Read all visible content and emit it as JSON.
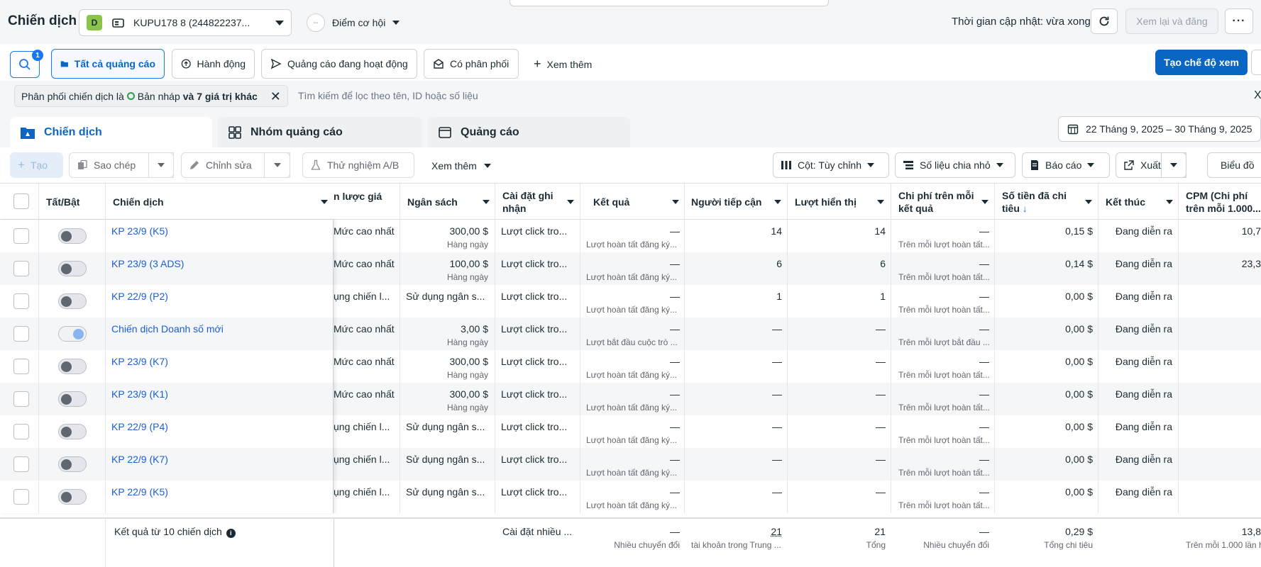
{
  "header": {
    "title": "Chiến dịch",
    "account_badge": "D",
    "account_name": "KUPU178 8 (244822237...",
    "opportunity_label": "Điểm cơ hội",
    "opportunity_icon": "--",
    "update_text": "Thời gian cập nhật: vừa xong",
    "review_label": "Xem lại và đăng"
  },
  "filters": {
    "search_badge": "1",
    "pills": [
      "Tất cả quảng cáo",
      "Hành động",
      "Quảng cáo đang hoạt động",
      "Có phân phối"
    ],
    "more_label": "Xem thêm",
    "create_view_label": "Tạo chế độ xem",
    "chip_prefix": "Phân phối chiến dịch là",
    "chip_value": "Bản nháp",
    "chip_suffix": "và 7 giá trị khác",
    "search_placeholder": "Tìm kiếm để lọc theo tên, ID hoặc số liệu",
    "clear_label": "X"
  },
  "levels": {
    "tabs": [
      "Chiến dịch",
      "Nhóm quảng cáo",
      "Quảng cáo"
    ],
    "date_range": "22 Tháng 9, 2025 – 30 Tháng 9, 2025"
  },
  "toolbar": {
    "create": "Tạo",
    "copy": "Sao chép",
    "edit": "Chỉnh sửa",
    "ab_test": "Thử nghiệm A/B",
    "more": "Xem thêm",
    "columns": "Cột: Tùy chỉnh",
    "breakdown": "Số liệu chia nhỏ",
    "reports": "Báo cáo",
    "export": "Xuất",
    "chart": "Biểu đồ"
  },
  "table": {
    "headers": {
      "toggle": "Tất/Bật",
      "campaign": "Chiến dịch",
      "bid": "n lược giá",
      "budget": "Ngân sách",
      "attribution_1": "Cài đặt ghi",
      "attribution_2": "nhận",
      "results": "Kết quả",
      "reach": "Người tiếp cận",
      "impressions": "Lượt hiển thị",
      "cpr_1": "Chi phí trên mỗi",
      "cpr_2": "kết quả",
      "spent_1": "Số tiền đã chi",
      "spent_2": "tiêu",
      "spent_sort": "↓",
      "ends": "Kết thúc",
      "cpm_1": "CPM (Chi phí",
      "cpm_2": "trên mỗi 1.000..."
    },
    "rows": [
      {
        "name": "KP 23/9 (K5)",
        "toggle": "off",
        "bid": "Mức cao nhất",
        "budget": "300,00 $",
        "budget_sub": "Hàng ngày",
        "attribution": "Lượt click tro...",
        "result": "—",
        "result_sub": "Lượt hoàn tất đăng ký...",
        "reach": "14",
        "impressions": "14",
        "cpr": "—",
        "cpr_sub": "Trên mỗi lượt hoàn tất...",
        "spent": "0,15 $",
        "ends": "Đang diễn ra",
        "cpm": "10,7"
      },
      {
        "name": "KP 23/9 (3 ADS)",
        "toggle": "off",
        "bid": "Mức cao nhất",
        "budget": "100,00 $",
        "budget_sub": "Hàng ngày",
        "attribution": "Lượt click tro...",
        "result": "—",
        "result_sub": "Lượt hoàn tất đăng ký...",
        "reach": "6",
        "impressions": "6",
        "cpr": "—",
        "cpr_sub": "Trên mỗi lượt hoàn tất...",
        "spent": "0,14 $",
        "ends": "Đang diễn ra",
        "cpm": "23,3"
      },
      {
        "name": "KP 22/9 (P2)",
        "toggle": "off",
        "bid": "ụng chiến l...",
        "budget": "Sử dụng ngân s...",
        "budget_sub": "",
        "attribution": "Lượt click tro...",
        "result": "—",
        "result_sub": "Lượt hoàn tất đăng ký...",
        "reach": "1",
        "impressions": "1",
        "cpr": "—",
        "cpr_sub": "Trên mỗi lượt hoàn tất...",
        "spent": "0,00 $",
        "ends": "Đang diễn ra",
        "cpm": ""
      },
      {
        "name": "Chiến dịch Doanh số mới",
        "toggle": "pending",
        "bid": "Mức cao nhất",
        "budget": "3,00 $",
        "budget_sub": "Hàng ngày",
        "attribution": "Lượt click tro...",
        "result": "—",
        "result_sub": "Lượt bắt đầu cuộc trò ...",
        "reach": "—",
        "impressions": "—",
        "cpr": "—",
        "cpr_sub": "Trên mỗi lượt bắt đầu ...",
        "spent": "0,00 $",
        "ends": "Đang diễn ra",
        "cpm": ""
      },
      {
        "name": "KP 23/9 (K7)",
        "toggle": "off",
        "bid": "Mức cao nhất",
        "budget": "300,00 $",
        "budget_sub": "Hàng ngày",
        "attribution": "Lượt click tro...",
        "result": "—",
        "result_sub": "Lượt hoàn tất đăng ký...",
        "reach": "—",
        "impressions": "—",
        "cpr": "—",
        "cpr_sub": "Trên mỗi lượt hoàn tất...",
        "spent": "0,00 $",
        "ends": "Đang diễn ra",
        "cpm": ""
      },
      {
        "name": "KP 23/9 (K1)",
        "toggle": "off",
        "bid": "Mức cao nhất",
        "budget": "300,00 $",
        "budget_sub": "Hàng ngày",
        "attribution": "Lượt click tro...",
        "result": "—",
        "result_sub": "Lượt hoàn tất đăng ký...",
        "reach": "—",
        "impressions": "—",
        "cpr": "—",
        "cpr_sub": "Trên mỗi lượt hoàn tất...",
        "spent": "0,00 $",
        "ends": "Đang diễn ra",
        "cpm": ""
      },
      {
        "name": "KP 22/9 (P4)",
        "toggle": "off",
        "bid": "ụng chiến l...",
        "budget": "Sử dụng ngân s...",
        "budget_sub": "",
        "attribution": "Lượt click tro...",
        "result": "—",
        "result_sub": "Lượt hoàn tất đăng ký...",
        "reach": "—",
        "impressions": "—",
        "cpr": "—",
        "cpr_sub": "Trên mỗi lượt hoàn tất...",
        "spent": "0,00 $",
        "ends": "Đang diễn ra",
        "cpm": ""
      },
      {
        "name": "KP 22/9 (K7)",
        "toggle": "off",
        "bid": "ụng chiến l...",
        "budget": "Sử dụng ngân s...",
        "budget_sub": "",
        "attribution": "Lượt click tro...",
        "result": "—",
        "result_sub": "Lượt hoàn tất đăng ký...",
        "reach": "—",
        "impressions": "—",
        "cpr": "—",
        "cpr_sub": "Trên mỗi lượt hoàn tất...",
        "spent": "0,00 $",
        "ends": "Đang diễn ra",
        "cpm": ""
      },
      {
        "name": "KP 22/9 (K5)",
        "toggle": "off",
        "bid": "ụng chiến l...",
        "budget": "Sử dụng ngân s...",
        "budget_sub": "",
        "attribution": "Lượt click tro...",
        "result": "—",
        "result_sub": "Lượt hoàn tất đăng ký...",
        "reach": "—",
        "impressions": "—",
        "cpr": "—",
        "cpr_sub": "Trên mỗi lượt hoàn tất...",
        "spent": "0,00 $",
        "ends": "Đang diễn ra",
        "cpm": ""
      }
    ],
    "footer": {
      "label": "Kết quả từ 10 chiến dịch",
      "info_icon": "i",
      "attribution": "Cài đặt nhiều ...",
      "result": "—",
      "result_sub": "Nhiều chuyển đổi",
      "reach": "21",
      "reach_sub": "tài khoản trong Trung ...",
      "impressions": "21",
      "impressions_sub": "Tổng",
      "cpr": "—",
      "cpr_sub": "Nhiều chuyển đổi",
      "spent": "0,29 $",
      "spent_sub": "Tổng chi tiêu",
      "cpm": "13,8",
      "cpm_sub": "Trên mỗi 1.000 lần h"
    }
  },
  "colors": {
    "accent": "#1877f2",
    "primary_button": "#0a66c2",
    "link": "#1a5fd0",
    "badge_green": "#8bc34a"
  }
}
